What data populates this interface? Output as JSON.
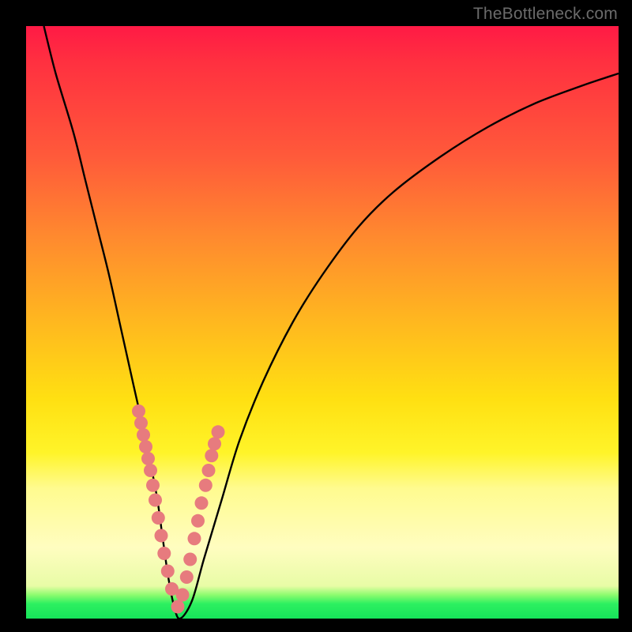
{
  "watermark": "TheBottleneck.com",
  "chart_data": {
    "type": "line",
    "title": "",
    "xlabel": "",
    "ylabel": "",
    "xlim": [
      0,
      100
    ],
    "ylim": [
      0,
      100
    ],
    "grid": false,
    "legend": false,
    "series": [
      {
        "name": "bottleneck-curve",
        "x": [
          3,
          5,
          8,
          10,
          12,
          14,
          16,
          18,
          20,
          22,
          23,
          24,
          25,
          26,
          28,
          30,
          33,
          36,
          40,
          45,
          50,
          56,
          62,
          70,
          78,
          86,
          94,
          100
        ],
        "y": [
          100,
          92,
          82,
          74,
          66,
          58,
          49,
          40,
          31,
          21,
          14,
          7,
          2,
          0,
          3,
          10,
          20,
          30,
          40,
          50,
          58,
          66,
          72,
          78,
          83,
          87,
          90,
          92
        ]
      }
    ],
    "sample_points": {
      "name": "sample-dots",
      "x": [
        19.0,
        19.4,
        19.8,
        20.2,
        20.6,
        21.0,
        21.4,
        21.8,
        22.3,
        22.8,
        23.3,
        23.9,
        24.6,
        25.6,
        26.4,
        27.1,
        27.7,
        28.4,
        29.0,
        29.6,
        30.3,
        30.8,
        31.3,
        31.8,
        32.4
      ],
      "y": [
        35.0,
        33.0,
        31.0,
        29.0,
        27.0,
        25.0,
        22.5,
        20.0,
        17.0,
        14.0,
        11.0,
        8.0,
        5.0,
        2.0,
        4.0,
        7.0,
        10.0,
        13.5,
        16.5,
        19.5,
        22.5,
        25.0,
        27.5,
        29.5,
        31.5
      ]
    },
    "gradient_stops": [
      {
        "pos": 0.0,
        "color": "#ff1a45"
      },
      {
        "pos": 0.22,
        "color": "#ff5a3a"
      },
      {
        "pos": 0.5,
        "color": "#ffb81f"
      },
      {
        "pos": 0.72,
        "color": "#fff429"
      },
      {
        "pos": 0.88,
        "color": "#fffdc0"
      },
      {
        "pos": 0.97,
        "color": "#2df060"
      },
      {
        "pos": 1.0,
        "color": "#16e45a"
      }
    ]
  }
}
